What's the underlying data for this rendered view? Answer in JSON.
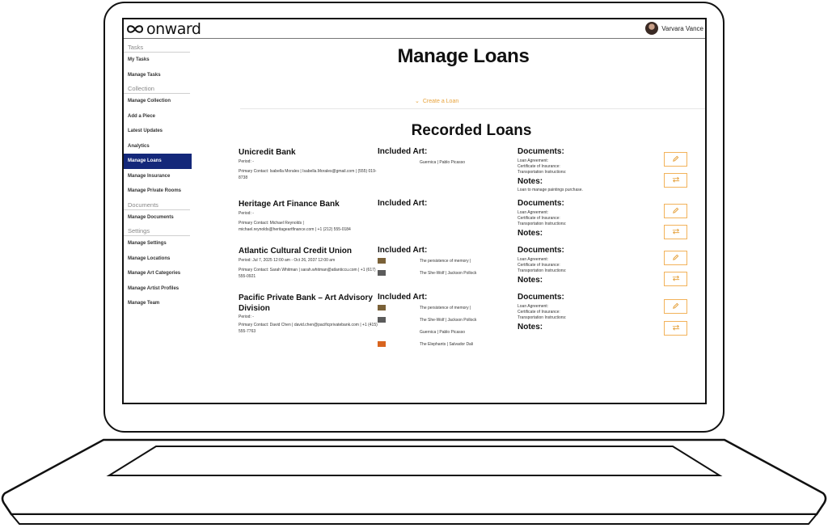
{
  "app": {
    "logo_text": "onward",
    "user_name": "Varvara Vance"
  },
  "sidebar": {
    "sections": [
      {
        "title": "Tasks",
        "items": [
          "My Tasks",
          "Manage Tasks"
        ]
      },
      {
        "title": "Collection",
        "items": [
          "Manage Collection",
          "Add a Piece",
          "Latest Updates",
          "Analytics",
          "Manage Loans",
          "Manage Insurance",
          "Manage Private Rooms"
        ]
      },
      {
        "title": "Documents",
        "items": [
          "Manage Documents"
        ]
      },
      {
        "title": "Settings",
        "items": [
          "Manage Settings",
          "Manage Locations",
          "Manage Art Categories",
          "Manage Artist Profiles",
          "Manage Team"
        ]
      }
    ],
    "active_item": "Manage Loans"
  },
  "main": {
    "title": "Manage Loans",
    "create_label": "Create a Loan",
    "section_title": "Recorded Loans",
    "included_art_heading": "Included Art:",
    "documents_heading": "Documents:",
    "notes_heading": "Notes:",
    "doc_types": [
      "Loan Agreement:",
      "Certificate of Insurance:",
      "Transportation Instructions:"
    ],
    "loans": [
      {
        "lender": "Unicredit Bank",
        "period": "Period: -",
        "contact": "Primary Contact: Isabella Morales | Isabella.Morales@gmail.com | (555) 019-8738",
        "art": [
          {
            "name": "Guernica | Pablo Picasso",
            "thumb": false,
            "color": ""
          }
        ],
        "notes": "Loan to manage paintings purchase."
      },
      {
        "lender": "Heritage Art Finance Bank",
        "period": "Period: -",
        "contact": "Primary Contact: Michael Reynolds | michael.reynolds@heritageartfinance.com | +1 (212) 555-0184",
        "art": [],
        "notes": ""
      },
      {
        "lender": "Atlantic Cultural Credit Union",
        "period": "Period: Jul 7, 2025 12:00 am - Oct 26, 2037 12:00 am",
        "contact": "Primary Contact: Sarah Whitman | sarah.whitman@atlanticcu.com | +1 (617) 555-0921",
        "art": [
          {
            "name": "The persistence of memory |",
            "thumb": true,
            "color": "#7a6138"
          },
          {
            "name": "The She-Wolf | Jackson Pollock",
            "thumb": true,
            "color": "#5b5b5b"
          }
        ],
        "notes": ""
      },
      {
        "lender": "Pacific Private Bank – Art Advisory Division",
        "period": "Period: -",
        "contact": "Primary Contact: David Chen | david.chen@pacificprivatebank.com | +1 (415) 555-7763",
        "art": [
          {
            "name": "The persistence of memory |",
            "thumb": true,
            "color": "#7a6138"
          },
          {
            "name": "The She-Wolf | Jackson Pollock",
            "thumb": true,
            "color": "#5b5b5b"
          },
          {
            "name": "Guernica | Pablo Picasso",
            "thumb": false,
            "color": ""
          },
          {
            "name": "The Elephants | Salvador Dali",
            "thumb": true,
            "color": "#d8641f"
          }
        ],
        "notes": ""
      }
    ],
    "icons": {
      "edit": "pencil-icon",
      "swap": "swap-arrows-icon",
      "create": "chevron-down-icon",
      "accent": "#f2b25a",
      "active_nav": "#14287a"
    }
  }
}
